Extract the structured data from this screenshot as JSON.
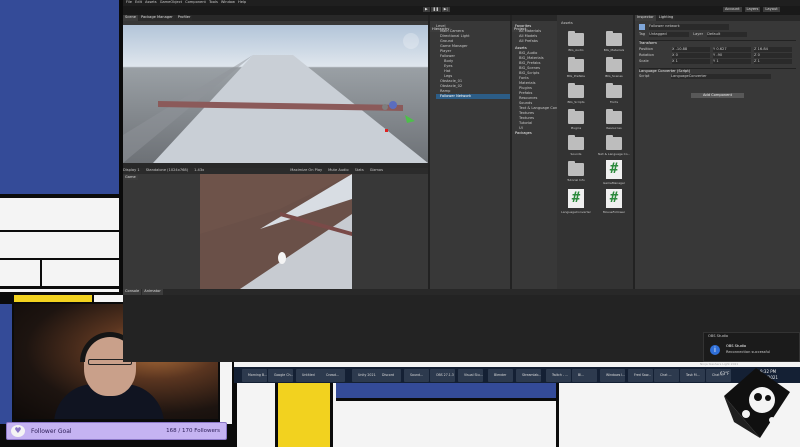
{
  "menu": [
    "File",
    "Edit",
    "Assets",
    "GameObject",
    "Component",
    "Tools",
    "Window",
    "Help"
  ],
  "toolbar": {
    "play": "▶",
    "pause": "❚❚",
    "step": "▶|",
    "account": "Account",
    "layers": "Layers",
    "layout": "Layout"
  },
  "scene_tabs": [
    "Scene",
    "Package Manager",
    "Profiler"
  ],
  "hierarchy": {
    "tab": "Hierarchy",
    "items": [
      "Level",
      "Main Camera",
      "Directional Light",
      "Ground",
      "Game Manager",
      "Player",
      "Follower",
      "Body",
      "Eyes",
      "Hat",
      "Legs",
      "Obstacle_01",
      "Obstacle_02",
      "Ramp",
      "Follower Network"
    ]
  },
  "project": {
    "tab": "Project",
    "favorites_label": "Favorites",
    "favorites": [
      "All Materials",
      "All Models",
      "All Prefabs"
    ],
    "assets_label": "Assets",
    "tree": [
      "BIG_Audio",
      "BIG_Materials",
      "BIG_Prefabs",
      "BIG_Scenes",
      "BIG_Scripts",
      "Fonts",
      "Materials",
      "Plugins",
      "Prefabs",
      "Resources",
      "Sounds",
      "Text & Language Conv",
      "Textures",
      "Textures",
      "Tutorial",
      "UI"
    ],
    "packages_label": "Packages",
    "grid_header": "Assets",
    "grid": [
      {
        "name": "BIG_Audio",
        "kind": "folder"
      },
      {
        "name": "BIG_Materials",
        "kind": "folder"
      },
      {
        "name": "BIG_Prefabs",
        "kind": "folder-open"
      },
      {
        "name": "BIG_Scenes",
        "kind": "folder"
      },
      {
        "name": "BIG_Scripts",
        "kind": "folder"
      },
      {
        "name": "Fonts",
        "kind": "folder"
      },
      {
        "name": "Plugins",
        "kind": "folder"
      },
      {
        "name": "Resources",
        "kind": "folder"
      },
      {
        "name": "Sounds",
        "kind": "folder"
      },
      {
        "name": "Text & Language Co...",
        "kind": "folder"
      },
      {
        "name": "Tutorial Info",
        "kind": "folder"
      },
      {
        "name": "GameManager",
        "kind": "script"
      },
      {
        "name": "LanguageConverter",
        "kind": "script"
      },
      {
        "name": "MouseFollower",
        "kind": "script"
      }
    ]
  },
  "inspector": {
    "tab": "Inspector",
    "tab2": "Lighting",
    "object_name": "Follower network",
    "tag_label": "Tag",
    "tag_value": "Untagged",
    "layer_label": "Layer",
    "layer_value": "Default",
    "transform_label": "Transform",
    "rows": [
      {
        "label": "Position",
        "x": "X -10.88",
        "y": "Y 0.627",
        "z": "Z 16.84"
      },
      {
        "label": "Rotation",
        "x": "X 0",
        "y": "Y -90",
        "z": "Z 0"
      },
      {
        "label": "Scale",
        "x": "X 1",
        "y": "Y 1",
        "z": "Z 1"
      }
    ],
    "component_label": "Language Converter (Script)",
    "script_label": "Script",
    "script_value": "LanguageConverter",
    "add_component": "Add Component"
  },
  "game_view": {
    "tab": "Game",
    "display": "Display 1",
    "resolution": "Standalone (1024x768)",
    "scale": "1.43x",
    "maximize": "Maximize On Play",
    "mute": "Mute Audio",
    "stats": "Stats",
    "gizmos": "Gizmos"
  },
  "bottom_tabs": [
    "Console",
    "Animator"
  ],
  "notification": {
    "app": "OBS Studio",
    "title": "OBS Studio",
    "message": "Reconnection successful"
  },
  "taskbar": {
    "items": [
      "Morning B...",
      "Google Ch...",
      "Untitled",
      "Crowd...",
      "Unity 2021...",
      "Discord",
      "Sound...",
      "OBS 27.1.3",
      "Visual Stu...",
      "Blender",
      "Streamlab...",
      "Twitch - ...",
      "Bl...",
      "Windows I...",
      "Fred Saw...",
      "Chat ...",
      "Task M...",
      "Chat ...",
      "OBS Pl...",
      "Stream..."
    ],
    "weather": "63°F",
    "time": "9:32 PM",
    "date": "9/2/2021",
    "tray_label": "Ninja Slashers Light 2021"
  },
  "follower_goal": {
    "label": "Follower Goal",
    "current": 168,
    "target": 170,
    "text": "168 / 170 Followers"
  },
  "colors": {
    "blue": "#344b98",
    "red": "#c02830",
    "yellow": "#f2d21f",
    "editor": "#383838",
    "goal": "#c5b3f2"
  }
}
